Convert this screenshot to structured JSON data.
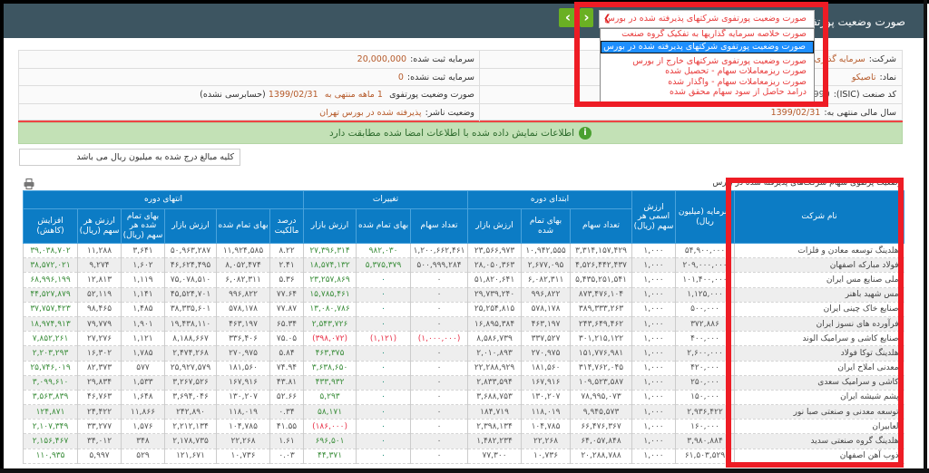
{
  "header": {
    "title": "صورت وضعیت پورتفوی",
    "prev_icon": "chevron-left-icon",
    "next_icon": "chevron-right-icon"
  },
  "report_select": {
    "selected": "صورت وضعیت پورتفوی شرکتهای پذیرفته شده در بورس",
    "options": [
      "صورت خلاصه سرمایه گذاریها به تفکیک گروه صنعت",
      "صورت وضعیت پورتفوی شرکتهای پذیرفته شده در بورس",
      "صورت وضعیت پورتفوی شرکتهای خارج از بورس",
      "صورت ریزمعاملات سهام - تحصیل شده",
      "صورت ریزمعاملات سهام - واگذار شده",
      "درامد حاصل از سود سهام محقق شده"
    ]
  },
  "info": {
    "company_label": "شرکت:",
    "company_value": "سرمایه گذاری م",
    "symbol_label": "نماد:",
    "symbol_value": "تاصیکو",
    "isic_label": "کد صنعت (ISIC):",
    "isic_value": "990",
    "fiscal_label": "سال مالی منتهی به:",
    "fiscal_value": "1399/02/31",
    "registered_label": "سرمایه ثبت شده:",
    "registered_value": "20,000,000",
    "unregistered_label": "سرمایه ثبت نشده:",
    "unregistered_value": "0",
    "period_prefix": "صورت وضعیت پورتفوی",
    "period_months": "1 ماهه منتهی به",
    "period_date": "1399/02/31",
    "period_status": "(حسابرسی نشده)",
    "publisher_label": "وضعیت ناشر:",
    "publisher_value": "پذیرفته شده در بورس تهران"
  },
  "status_message": "اطلاعات نمایش داده شده با اطلاعات امضا شده مطابقت دارد",
  "units_note": "کلیه مبالغ درج شده به میلیون ریال می باشد",
  "table_caption": "وضعیت پرتفوی سهام شرکت‌های پذیرفته شده در بورس",
  "table": {
    "groups": [
      "ابتدای دوره",
      "تغییرات",
      "انتهای دوره"
    ],
    "columns": [
      "نام شرکت",
      "سرمایه (میلیون ریال)",
      "ارزش اسمی هر سهم (ریال)",
      "تعداد سهام",
      "بهای تمام شده",
      "ارزش بازار",
      "تعداد سهام",
      "بهای تمام شده",
      "ارزش بازار",
      "درصد مالکیت",
      "بهای تمام شده",
      "ارزش بازار",
      "بهای تمام شده هر سهم (ریال)",
      "ارزش هر سهم (ریال)",
      "افزایش (کاهش)"
    ],
    "rows": [
      [
        "هلدینگ توسعه معادن و فلزات",
        "۵۴,۹۰۰,۰۰۰",
        "۱,۰۰۰",
        "۳,۳۱۴,۱۵۷,۴۲۹",
        "۱۰,۹۴۲,۵۵۵",
        "۲۳,۵۶۶,۹۷۳",
        "۱,۲۰۰,۶۶۲,۴۶۱",
        "۹۸۲,۰۳۰",
        "۲۷,۳۹۶,۳۱۴",
        "۸.۲۲",
        "۱۱,۹۲۴,۵۸۵",
        "۵۰,۹۶۳,۲۸۷",
        "۳,۶۴۱",
        "۱۱,۲۸۸",
        "۳۹,۰۳۸,۷۰۲"
      ],
      [
        "فولاد مبارکه اصفهان",
        "۲۰۹,۰۰۰,۰۰۰",
        "۱,۰۰۰",
        "۴,۵۲۶,۴۴۲,۴۳۷",
        "۲,۶۷۷,۰۹۵",
        "۲۸,۰۵۰,۳۶۳",
        "۵۰۰,۹۹۹,۲۸۴",
        "۵,۳۷۵,۳۷۹",
        "۱۸,۵۷۴,۱۳۲",
        "۲.۴۱",
        "۸,۰۵۲,۴۷۴",
        "۴۶,۶۲۴,۴۹۵",
        "۱,۶۰۲",
        "۹,۲۷۴",
        "۳۸,۵۷۲,۰۲۱"
      ],
      [
        "ملی صنایع مس ایران",
        "۱۰۱,۴۰۰,۰۰۰",
        "۱,۰۰۰",
        "۵,۴۳۵,۲۵۱,۵۴۱",
        "۶,۰۸۲,۳۱۱",
        "۵۱,۸۲۰,۶۴۱",
        "۰",
        "۰",
        "۲۳,۲۵۷,۸۶۹",
        "۵.۳۶",
        "۶,۰۸۲,۳۱۱",
        "۷۵,۰۷۸,۵۱۰",
        "۱,۱۱۹",
        "۱۲,۸۱۳",
        "۶۸,۹۹۶,۱۹۹"
      ],
      [
        "مس شهید باهنر",
        "۱,۱۲۵,۰۰۰",
        "۱,۰۰۰",
        "۸۷۳,۴۷۶,۱۰۴",
        "۹۹۶,۸۲۲",
        "۲۹,۷۳۹,۲۴۰",
        "۰",
        "۰",
        "۱۵,۷۸۵,۴۶۱",
        "۷۷.۶۴",
        "۹۹۶,۸۲۲",
        "۴۵,۵۲۴,۷۰۱",
        "۱,۱۴۱",
        "۵۲,۱۱۹",
        "۴۴,۵۲۷,۸۷۹"
      ],
      [
        "صنایع خاک چینی ایران",
        "۵۰۰,۰۰۰",
        "۱,۰۰۰",
        "۳۸۹,۳۳۳,۲۶۳",
        "۵۷۸,۱۷۸",
        "۲۵,۲۵۴,۸۱۵",
        "۰",
        "۰",
        "۱۳,۰۸۰,۷۸۶",
        "۷۷.۸۷",
        "۵۷۸,۱۷۸",
        "۳۸,۳۳۵,۶۰۱",
        "۱,۴۸۵",
        "۹۸,۴۶۵",
        "۳۷,۷۵۷,۴۲۳"
      ],
      [
        "فرآورده های نسوز ایران",
        "۳۷۲,۸۸۶",
        "۱,۰۰۰",
        "۲۴۳,۶۴۹,۴۶۲",
        "۴۶۳,۱۹۷",
        "۱۶,۸۹۵,۳۸۴",
        "۰",
        "۰",
        "۲,۵۴۳,۷۲۶",
        "۶۵.۳۴",
        "۴۶۳,۱۹۷",
        "۱۹,۴۳۸,۱۱۰",
        "۱,۹۰۱",
        "۷۹,۷۷۹",
        "۱۸,۹۷۴,۹۱۳"
      ],
      [
        "صنایع کاشی و سرامیک الوند",
        "۴۰۰,۰۰۰",
        "۱,۰۰۰",
        "۳۰۱,۲۱۵,۱۲۲",
        "۳۳۷,۵۲۷",
        "۸,۵۸۶,۷۳۹",
        "(۱,۰۰۰,۰۰۰)",
        "(۱,۱۲۱)",
        "(۳۹۸,۰۷۲)",
        "۷۵.۰۵",
        "۳۳۶,۴۰۶",
        "۸,۱۸۸,۶۶۷",
        "۱,۱۲۱",
        "۲۷,۲۷۶",
        "۷,۸۵۲,۲۶۱"
      ],
      [
        "هلدینگ توکا فولاد",
        "۲,۶۰۰,۰۰۰",
        "۱,۰۰۰",
        "۱۵۱,۷۷۶,۹۸۱",
        "۲۷۰,۹۷۵",
        "۲,۰۱۰,۸۹۳",
        "۰",
        "۰",
        "۴۶۳,۳۷۵",
        "۵.۸۴",
        "۲۷۰,۹۷۵",
        "۲,۴۷۴,۲۶۸",
        "۱,۷۸۵",
        "۱۶,۳۰۲",
        "۲,۲۰۳,۲۹۳"
      ],
      [
        "معدنی املاح ایران",
        "۴۲۰,۰۰۰",
        "۱,۰۰۰",
        "۳۱۴,۷۶۲,۰۴۵",
        "۱۸۱,۵۶۰",
        "۲۲,۲۸۸,۹۲۹",
        "۰",
        "۰",
        "۳,۶۳۸,۶۵۰",
        "۷۴.۹۴",
        "۱۸۱,۵۶۰",
        "۲۵,۹۲۷,۵۷۹",
        "۵۷۷",
        "۸۲,۳۷۳",
        "۲۵,۷۴۶,۰۱۹"
      ],
      [
        "کاشی و سرامیک سعدی",
        "۲۵۰,۰۰۰",
        "۱,۰۰۰",
        "۱۰۹,۵۲۳,۵۸۷",
        "۱۶۷,۹۱۶",
        "۲,۸۳۳,۵۹۴",
        "۰",
        "۰",
        "۴۳۳,۹۳۲",
        "۴۳.۸۱",
        "۱۶۷,۹۱۶",
        "۳,۲۶۷,۵۲۶",
        "۱,۵۳۳",
        "۲۹,۸۳۴",
        "۳,۰۹۹,۶۱۰"
      ],
      [
        "پشم شیشه ایران",
        "۱۵۰,۰۰۰",
        "۱,۰۰۰",
        "۷۸,۹۹۵,۰۷۳",
        "۱۳۰,۲۰۷",
        "۳,۶۸۸,۷۵۳",
        "۰",
        "۰",
        "۵,۲۹۳",
        "۵۲.۶۶",
        "۱۳۰,۲۰۷",
        "۳,۶۹۴,۰۴۶",
        "۱,۶۴۸",
        "۴۶,۷۶۳",
        "۳,۵۶۳,۸۳۹"
      ],
      [
        "توسعه معدنی و صنعتی صبا نور",
        "۲,۹۳۶,۴۲۲",
        "۱,۰۰۰",
        "۹,۹۴۵,۵۷۳",
        "۱۱۸,۰۱۹",
        "۱۸۴,۷۱۹",
        "۰",
        "۰",
        "۵۸,۱۷۱",
        "۰.۳۴",
        "۱۱۸,۰۱۹",
        "۲۴۲,۸۹۰",
        "۱۱,۸۶۶",
        "۲۴,۴۲۲",
        "۱۲۴,۸۷۱"
      ],
      [
        "لعابیران",
        "۱۶۰,۰۰۰",
        "۱,۰۰۰",
        "۶۶,۴۷۶,۳۶۷",
        "۱۰۴,۷۸۵",
        "۲,۳۹۸,۱۳۴",
        "۰",
        "۰",
        "(۱۸۶,۰۰۰)",
        "۴۱.۵۵",
        "۱۰۴,۷۸۵",
        "۲,۲۱۲,۱۳۴",
        "۱,۵۷۶",
        "۳۳,۲۷۷",
        "۲,۱۰۷,۳۴۹"
      ],
      [
        "هلدینگ گروه صنعتی سدید",
        "۳,۹۸۰,۸۸۴",
        "۱,۰۰۰",
        "۶۴,۰۵۷,۸۴۸",
        "۲۲,۲۶۸",
        "۱,۴۸۲,۲۳۴",
        "۰",
        "۰",
        "۶۹۶,۵۰۱",
        "۱.۶۱",
        "۲۲,۲۶۸",
        "۲,۱۷۸,۷۳۵",
        "۳۴۸",
        "۳۴,۰۱۲",
        "۲,۱۵۶,۴۶۷"
      ],
      [
        "ذوب آهن اصفهان",
        "۶۱,۵۰۳,۵۲۹",
        "۱,۰۰۰",
        "۲۰,۲۸۸,۷۸۸",
        "۱۰,۷۳۶",
        "۷۷,۳۰۰",
        "۰",
        "۰",
        "۴۴,۳۷۱",
        "۰.۰۳",
        "۱۰,۷۳۶",
        "۱۲۱,۶۷۱",
        "۵۲۹",
        "۵,۹۹۷",
        "۱۱۰,۹۳۵"
      ]
    ]
  },
  "colors": {
    "header_bg": "#3d5561",
    "table_header": "#0c7cc5",
    "highlight": "#ee1c25",
    "nav_button": "#6ab023",
    "positive": "#3c8e3c",
    "negative": "#e8334a",
    "success_bar": "#c3e1b6"
  }
}
